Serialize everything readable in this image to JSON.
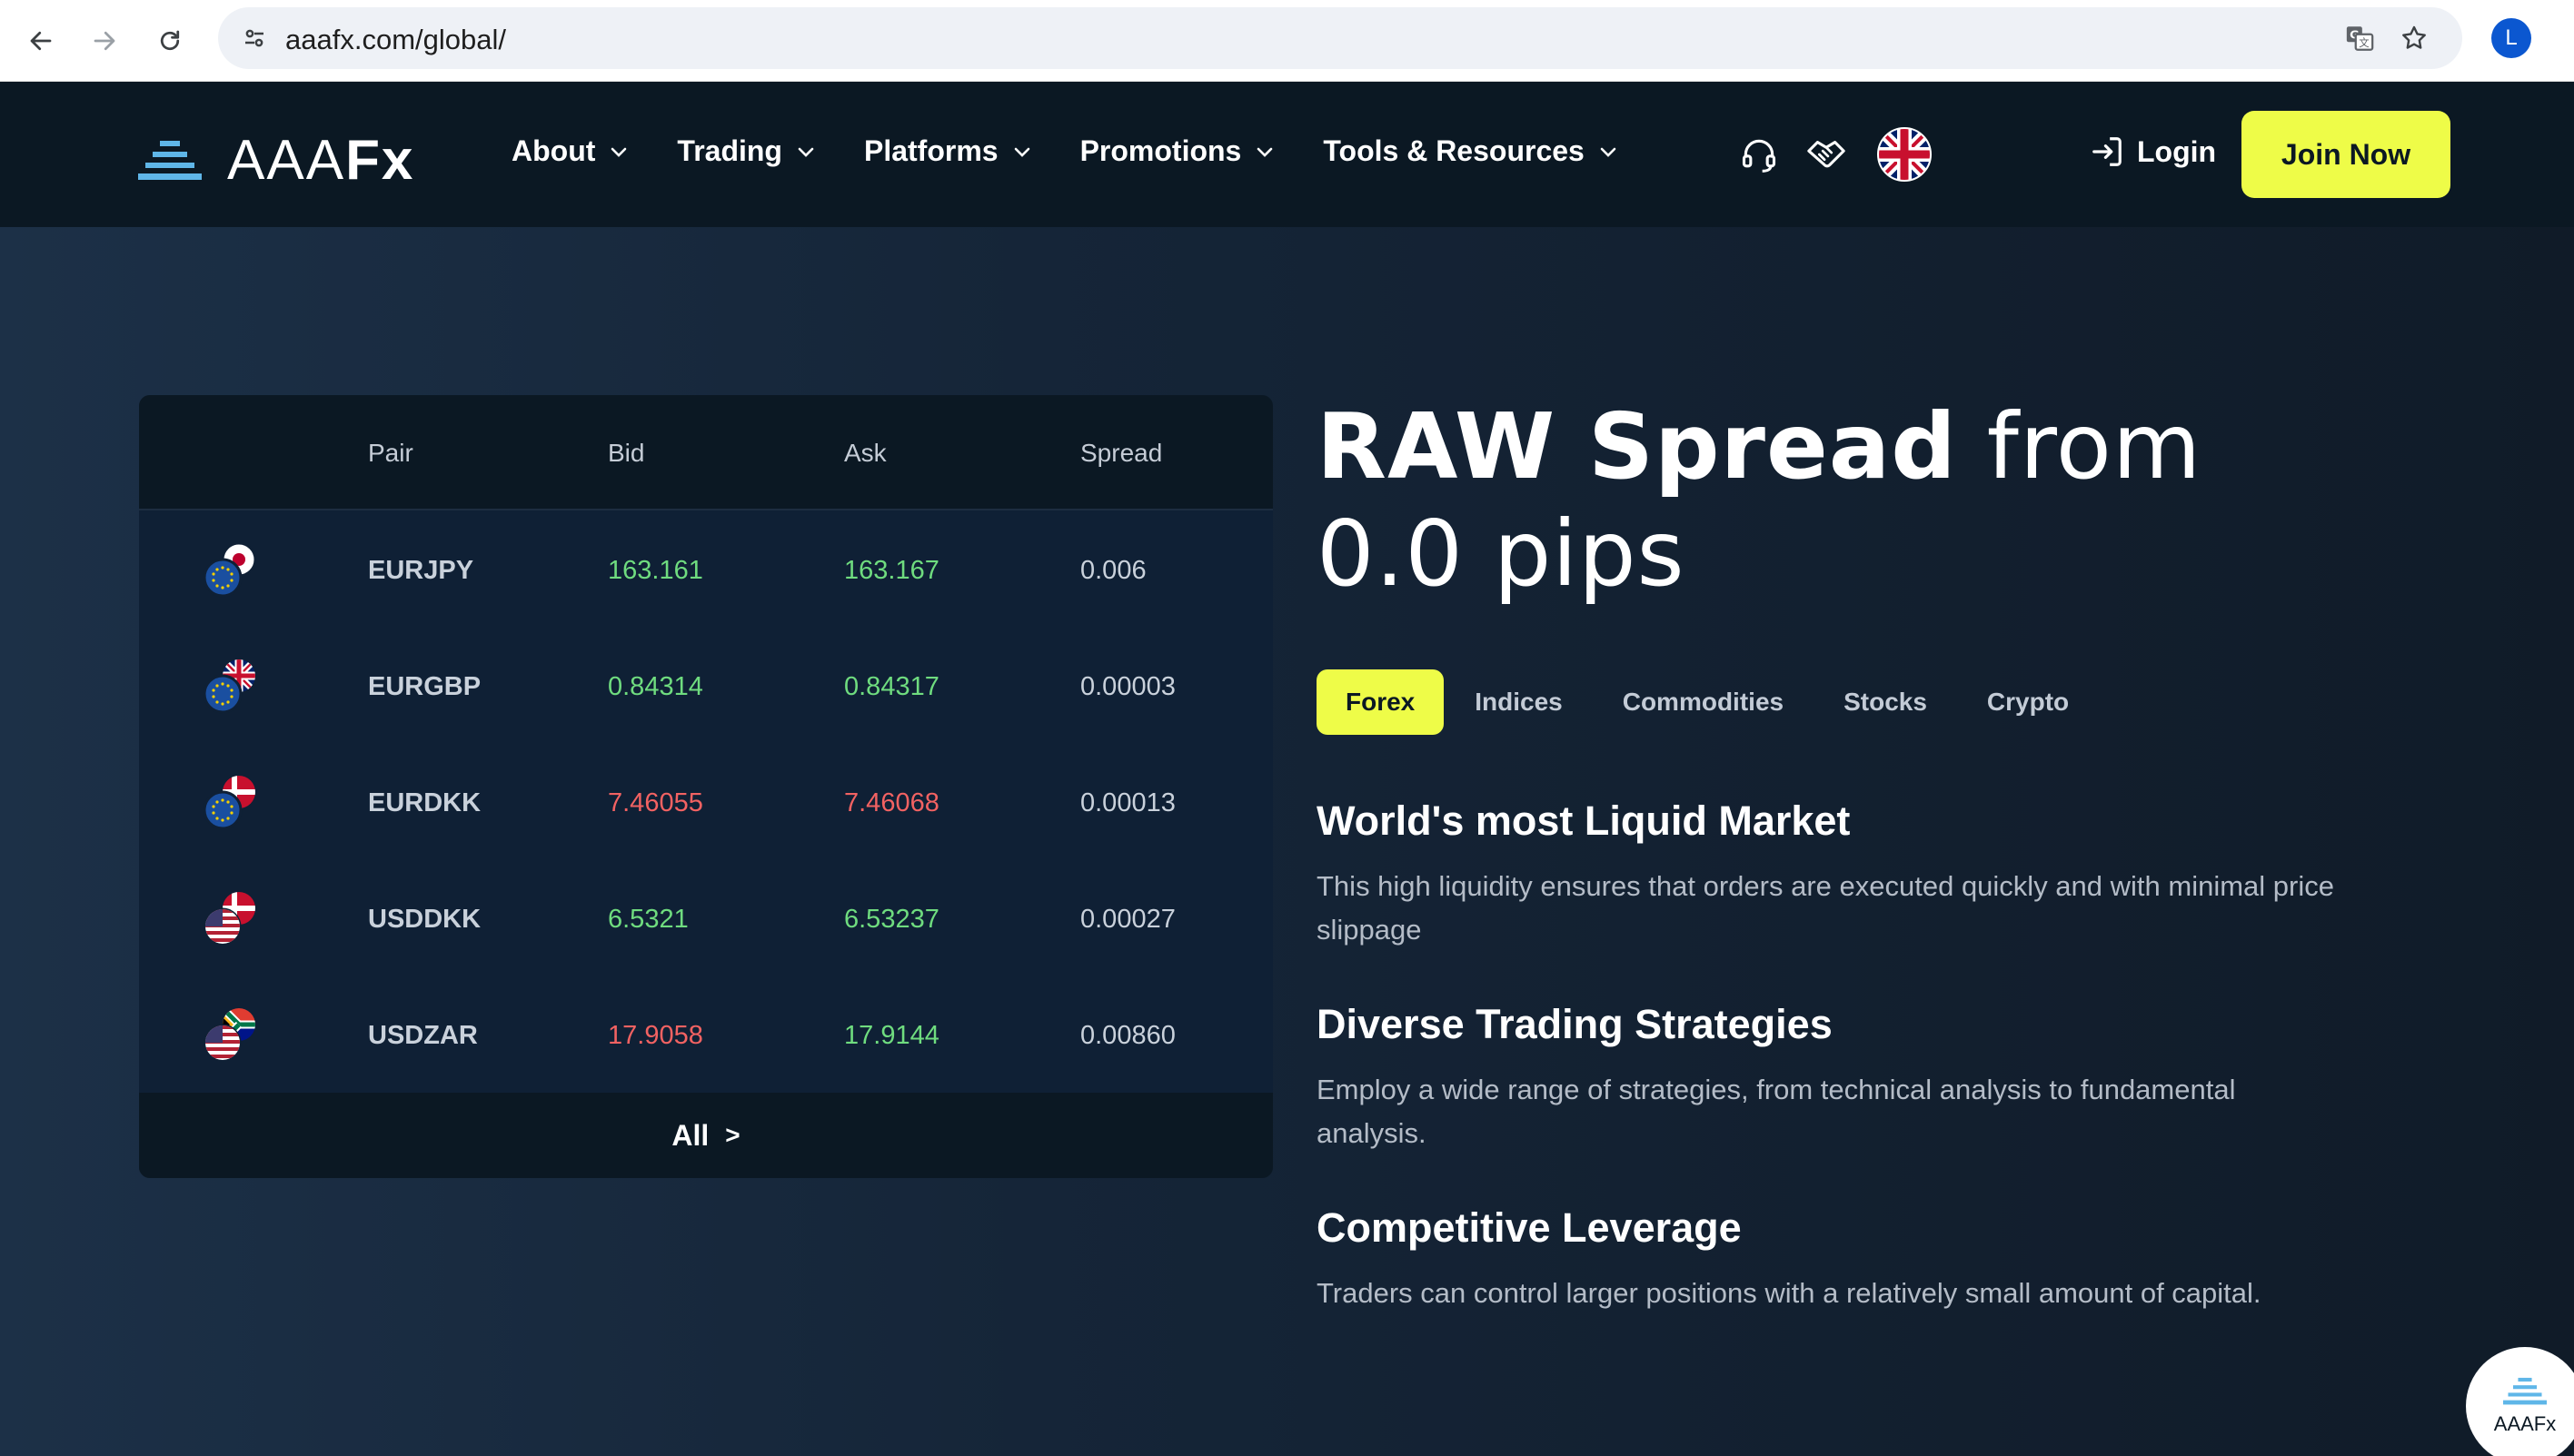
{
  "browser": {
    "url": "aaafx.com/global/",
    "profile_initial": "L"
  },
  "header": {
    "logo_light": "AAA",
    "logo_bold": "Fx",
    "nav": [
      {
        "label": "About"
      },
      {
        "label": "Trading"
      },
      {
        "label": "Platforms"
      },
      {
        "label": "Promotions"
      },
      {
        "label": "Tools & Resources"
      }
    ],
    "login_label": "Login",
    "join_label": "Join Now"
  },
  "table": {
    "columns": [
      "Pair",
      "Bid",
      "Ask",
      "Spread"
    ],
    "rows": [
      {
        "pair": "EURJPY",
        "bid": "163.161",
        "ask": "163.167",
        "spread": "0.006",
        "direction": "up",
        "flags": [
          "eu",
          "jp"
        ]
      },
      {
        "pair": "EURGBP",
        "bid": "0.84314",
        "ask": "0.84317",
        "spread": "0.00003",
        "direction": "up",
        "flags": [
          "eu",
          "gb"
        ]
      },
      {
        "pair": "EURDKK",
        "bid": "7.46055",
        "ask": "7.46068",
        "spread": "0.00013",
        "direction": "down",
        "flags": [
          "eu",
          "dk"
        ]
      },
      {
        "pair": "USDDKK",
        "bid": "6.5321",
        "ask": "6.53237",
        "spread": "0.00027",
        "direction": "up",
        "flags": [
          "us",
          "dk"
        ]
      },
      {
        "pair": "USDZAR",
        "bid": "17.9058",
        "ask": "17.9144",
        "spread": "0.00860",
        "direction": "down",
        "flags": [
          "us",
          "za"
        ]
      }
    ],
    "all_label": "All",
    "all_arrow": ">"
  },
  "hero": {
    "headline_bold": "RAW Spread",
    "headline_light_1": "from",
    "headline_light_2": "0.0 pips",
    "tabs": [
      "Forex",
      "Indices",
      "Commodities",
      "Stocks",
      "Crypto"
    ],
    "active_tab": "Forex",
    "features": [
      {
        "title": "World's most Liquid Market",
        "text": "This high liquidity ensures that orders are executed quickly and with minimal price slippage"
      },
      {
        "title": "Diverse Trading Strategies",
        "text": "Employ a wide range of strategies, from technical analysis to fundamental analysis."
      },
      {
        "title": "Competitive Leverage",
        "text": "Traders can control larger positions with a relatively small amount of capital."
      }
    ]
  },
  "chat_widget": {
    "label": "AAAFx"
  },
  "colors": {
    "accent": "#eefc48",
    "up": "#6fdc7f",
    "down": "#f26262",
    "header_bg": "#0b1823",
    "logo_blue": "#5fb6e8"
  },
  "icons": [
    "back-arrow-icon",
    "forward-arrow-icon",
    "reload-icon",
    "site-settings-icon",
    "translate-icon",
    "bookmark-star-icon",
    "headset-icon",
    "handshake-icon",
    "uk-flag-icon",
    "login-icon",
    "chevron-down-icon"
  ]
}
